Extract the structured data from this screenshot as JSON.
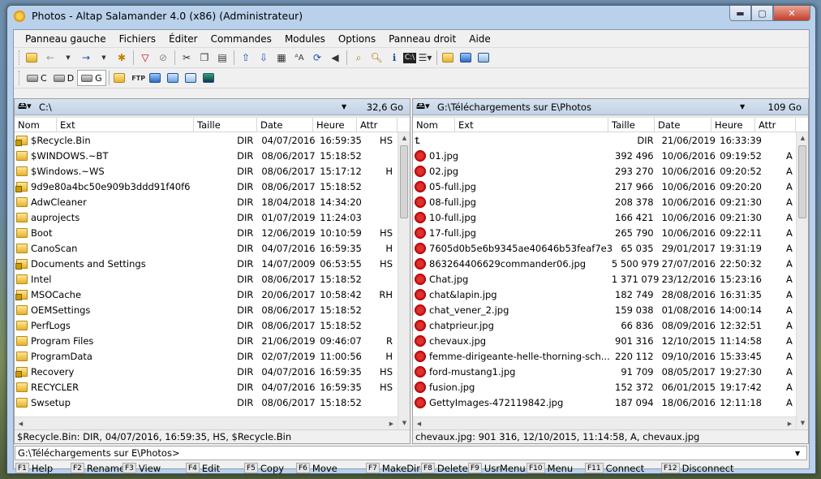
{
  "window": {
    "title": "Photos - Altap Salamander 4.0 (x86) (Administrateur)",
    "buttons": {
      "minimize": "▬",
      "maximize": "▢",
      "close": "✕"
    }
  },
  "menu": [
    "Panneau gauche",
    "Fichiers",
    "Éditer",
    "Commandes",
    "Modules",
    "Options",
    "Panneau droit",
    "Aide"
  ],
  "drives": [
    {
      "label": "C",
      "active": false
    },
    {
      "label": "D",
      "active": false
    },
    {
      "label": "G",
      "active": true
    }
  ],
  "columns": {
    "name": "Nom",
    "ext": "Ext",
    "size": "Taille",
    "date": "Date",
    "time": "Heure",
    "attr": "Attr"
  },
  "left_panel": {
    "path": "C:\\",
    "free": "32,6 Go",
    "status": "$Recycle.Bin: DIR, 04/07/2016, 16:59:35, HS, $Recycle.Bin",
    "rows": [
      {
        "icon": "lockfolder",
        "name": "$Recycle.Bin",
        "size": "DIR",
        "date": "04/07/2016",
        "time": "16:59:35",
        "attr": "HS"
      },
      {
        "icon": "folder",
        "name": "$WINDOWS.~BT",
        "size": "DIR",
        "date": "08/06/2017",
        "time": "15:18:52",
        "attr": ""
      },
      {
        "icon": "folder",
        "name": "$Windows.~WS",
        "size": "DIR",
        "date": "08/06/2017",
        "time": "15:17:12",
        "attr": "H"
      },
      {
        "icon": "lockfolder",
        "name": "9d9e80a4bc50e909b3ddd91f40f6",
        "size": "DIR",
        "date": "08/06/2017",
        "time": "15:18:52",
        "attr": ""
      },
      {
        "icon": "folder",
        "name": "AdwCleaner",
        "size": "DIR",
        "date": "18/04/2018",
        "time": "14:34:20",
        "attr": ""
      },
      {
        "icon": "folder",
        "name": "auprojects",
        "size": "DIR",
        "date": "01/07/2019",
        "time": "11:24:03",
        "attr": ""
      },
      {
        "icon": "folder",
        "name": "Boot",
        "size": "DIR",
        "date": "12/06/2019",
        "time": "10:10:59",
        "attr": "HS"
      },
      {
        "icon": "folder",
        "name": "CanoScan",
        "size": "DIR",
        "date": "04/07/2016",
        "time": "16:59:35",
        "attr": "H"
      },
      {
        "icon": "lockfolder",
        "name": "Documents and Settings",
        "size": "DIR",
        "date": "14/07/2009",
        "time": "06:53:55",
        "attr": "HS"
      },
      {
        "icon": "folder",
        "name": "Intel",
        "size": "DIR",
        "date": "08/06/2017",
        "time": "15:18:52",
        "attr": ""
      },
      {
        "icon": "lockfolder",
        "name": "MSOCache",
        "size": "DIR",
        "date": "20/06/2017",
        "time": "10:58:42",
        "attr": "RH"
      },
      {
        "icon": "folder",
        "name": "OEMSettings",
        "size": "DIR",
        "date": "08/06/2017",
        "time": "15:18:52",
        "attr": ""
      },
      {
        "icon": "folder",
        "name": "PerfLogs",
        "size": "DIR",
        "date": "08/06/2017",
        "time": "15:18:52",
        "attr": ""
      },
      {
        "icon": "folder",
        "name": "Program Files",
        "size": "DIR",
        "date": "21/06/2019",
        "time": "09:46:07",
        "attr": "R"
      },
      {
        "icon": "folder",
        "name": "ProgramData",
        "size": "DIR",
        "date": "02/07/2019",
        "time": "11:00:56",
        "attr": "H"
      },
      {
        "icon": "lockfolder",
        "name": "Recovery",
        "size": "DIR",
        "date": "04/07/2016",
        "time": "16:59:35",
        "attr": "HS"
      },
      {
        "icon": "folder",
        "name": "RECYCLER",
        "size": "DIR",
        "date": "04/07/2016",
        "time": "16:59:35",
        "attr": "HS"
      },
      {
        "icon": "folder",
        "name": "Swsetup",
        "size": "DIR",
        "date": "08/06/2017",
        "time": "15:18:52",
        "attr": ""
      }
    ]
  },
  "right_panel": {
    "path": "G:\\Téléchargements sur E\\Photos",
    "free": "109 Go",
    "status": "chevaux.jpg: 901 316, 12/10/2015, 11:14:58, A, chevaux.jpg",
    "rows": [
      {
        "icon": "up",
        "name": "",
        "size": "DIR",
        "date": "21/06/2019",
        "time": "16:33:39",
        "attr": ""
      },
      {
        "icon": "jpg",
        "name": "01.jpg",
        "size": "392 496",
        "date": "10/06/2016",
        "time": "09:19:52",
        "attr": "A"
      },
      {
        "icon": "jpg",
        "name": "02.jpg",
        "size": "293 270",
        "date": "10/06/2016",
        "time": "09:20:52",
        "attr": "A"
      },
      {
        "icon": "jpg",
        "name": "05-full.jpg",
        "size": "217 966",
        "date": "10/06/2016",
        "time": "09:20:20",
        "attr": "A"
      },
      {
        "icon": "jpg",
        "name": "08-full.jpg",
        "size": "208 378",
        "date": "10/06/2016",
        "time": "09:21:30",
        "attr": "A"
      },
      {
        "icon": "jpg",
        "name": "10-full.jpg",
        "size": "166 421",
        "date": "10/06/2016",
        "time": "09:21:30",
        "attr": "A"
      },
      {
        "icon": "jpg",
        "name": "17-full.jpg",
        "size": "265 790",
        "date": "10/06/2016",
        "time": "09:22:11",
        "attr": "A"
      },
      {
        "icon": "jpg",
        "name": "7605d0b5e6b9345ae40646b53feaf7e3.jpg",
        "size": "65 035",
        "date": "29/01/2017",
        "time": "19:31:19",
        "attr": "A"
      },
      {
        "icon": "jpg",
        "name": "863264406629commander06.jpg",
        "size": "5 500 979",
        "date": "27/07/2016",
        "time": "22:50:32",
        "attr": "A"
      },
      {
        "icon": "jpg",
        "name": "Chat.jpg",
        "size": "1 371 079",
        "date": "23/12/2016",
        "time": "15:23:16",
        "attr": "A"
      },
      {
        "icon": "jpg",
        "name": "chat&lapin.jpg",
        "size": "182 749",
        "date": "28/08/2016",
        "time": "16:31:35",
        "attr": "A"
      },
      {
        "icon": "jpg",
        "name": "chat_vener_2.jpg",
        "size": "159 038",
        "date": "01/08/2016",
        "time": "14:00:14",
        "attr": "A"
      },
      {
        "icon": "jpg",
        "name": "chatprieur.jpg",
        "size": "66 836",
        "date": "08/09/2016",
        "time": "12:32:51",
        "attr": "A"
      },
      {
        "icon": "jpg",
        "name": "chevaux.jpg",
        "size": "901 316",
        "date": "12/10/2015",
        "time": "11:14:58",
        "attr": "A"
      },
      {
        "icon": "jpg",
        "name": "femme-dirigeante-helle-thorning-sch...",
        "size": "220 112",
        "date": "09/10/2016",
        "time": "15:33:45",
        "attr": "A"
      },
      {
        "icon": "jpg",
        "name": "ford-mustang1.jpg",
        "size": "91 709",
        "date": "08/05/2017",
        "time": "19:27:30",
        "attr": "A"
      },
      {
        "icon": "jpg",
        "name": "fusion.jpg",
        "size": "152 372",
        "date": "06/01/2015",
        "time": "19:17:42",
        "attr": "A"
      },
      {
        "icon": "jpg",
        "name": "GettyImages-472119842.jpg",
        "size": "187 094",
        "date": "18/06/2016",
        "time": "12:11:18",
        "attr": "A"
      }
    ]
  },
  "command_line": "G:\\Téléchargements sur E\\Photos>",
  "fkeys": [
    {
      "key": "F1",
      "label": "Help"
    },
    {
      "key": "F2",
      "label": "Rename"
    },
    {
      "key": "F3",
      "label": "View"
    },
    {
      "key": "F4",
      "label": "Edit"
    },
    {
      "key": "F5",
      "label": "Copy"
    },
    {
      "key": "F6",
      "label": "Move"
    },
    {
      "key": "F7",
      "label": "MakeDir"
    },
    {
      "key": "F8",
      "label": "Delete"
    },
    {
      "key": "F9",
      "label": "UsrMenu"
    },
    {
      "key": "F10",
      "label": "Menu"
    },
    {
      "key": "F11",
      "label": "Connect"
    },
    {
      "key": "F12",
      "label": "Disconnect"
    }
  ]
}
